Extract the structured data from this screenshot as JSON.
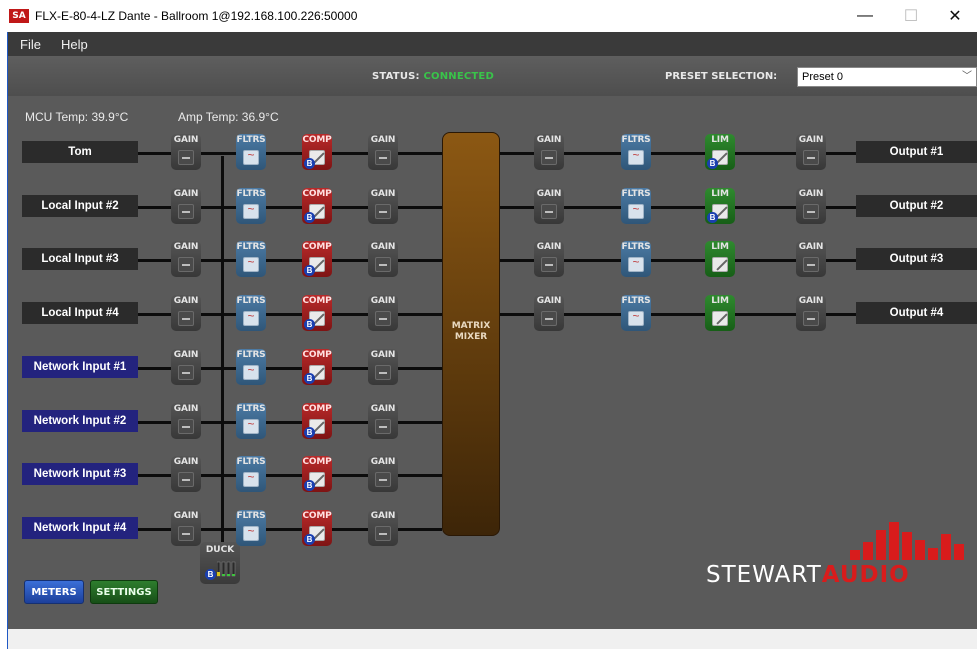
{
  "window": {
    "icon_text": "SA",
    "title": "FLX-E-80-4-LZ Dante - Ballroom 1@192.168.100.226:50000",
    "minimize": "—",
    "maximize": "☐",
    "close": "✕"
  },
  "menu": {
    "file": "File",
    "help": "Help"
  },
  "status": {
    "label": "STATUS:",
    "value": "CONNECTED",
    "value_color": "#39c44a"
  },
  "preset": {
    "label": "PRESET SELECTION:",
    "selected": "Preset 0"
  },
  "temps": {
    "mcu": "MCU Temp: 39.9°C",
    "amp": "Amp Temp: 36.9°C"
  },
  "inputs": [
    {
      "label": "Tom",
      "type": "local"
    },
    {
      "label": "Local Input #2",
      "type": "local"
    },
    {
      "label": "Local Input #3",
      "type": "local"
    },
    {
      "label": "Local Input #4",
      "type": "local"
    },
    {
      "label": "Network Input #1",
      "type": "network"
    },
    {
      "label": "Network Input #2",
      "type": "network"
    },
    {
      "label": "Network Input #3",
      "type": "network"
    },
    {
      "label": "Network Input #4",
      "type": "network"
    }
  ],
  "outputs": [
    {
      "label": "Output #1",
      "lim_bypass": true
    },
    {
      "label": "Output #2",
      "lim_bypass": true
    },
    {
      "label": "Output #3",
      "lim_bypass": false
    },
    {
      "label": "Output #4",
      "lim_bypass": false
    }
  ],
  "blocks": {
    "gain": "GAIN",
    "filters": "FLTRS",
    "comp": "COMP",
    "lim": "LIM",
    "bypass_badge": "B"
  },
  "matrix": {
    "line1": "MATRIX",
    "line2": "MIXER"
  },
  "duck": {
    "title": "DUCK",
    "badge": "B"
  },
  "buttons": {
    "meters": "METERS",
    "settings": "SETTINGS"
  },
  "logo": {
    "part1": "STEWART",
    "part2": "AUDIO"
  },
  "colors": {
    "local_label": "#2b2b2b",
    "network_label": "#23237e",
    "comp": "#b92a2a",
    "filters": "#3f6c94",
    "lim": "#2f8a2f",
    "matrix": "#6e4510",
    "logo_red": "#d81c1c"
  }
}
